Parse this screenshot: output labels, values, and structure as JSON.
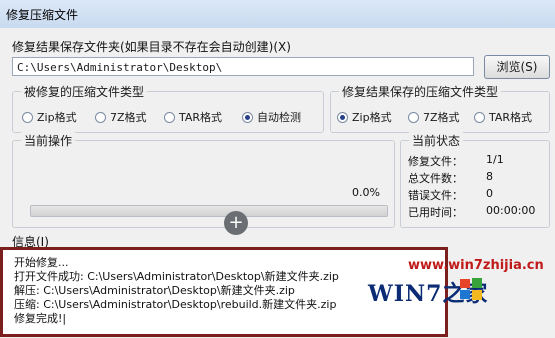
{
  "window": {
    "title": "修复压缩文件"
  },
  "save_folder": {
    "label": "修复结果保存文件夹(如果目录不存在会自动创建)(X)",
    "path": "C:\\Users\\Administrator\\Desktop\\",
    "browse_button": "浏览(S)"
  },
  "source_type": {
    "title": "被修复的压缩文件类型",
    "options": [
      {
        "label": "Zip格式",
        "selected": false
      },
      {
        "label": "7Z格式",
        "selected": false
      },
      {
        "label": "TAR格式",
        "selected": false
      },
      {
        "label": "自动检测",
        "selected": true
      }
    ]
  },
  "output_type": {
    "title": "修复结果保存的压缩文件类型",
    "options": [
      {
        "label": "Zip格式",
        "selected": true
      },
      {
        "label": "7Z格式",
        "selected": false
      },
      {
        "label": "TAR格式",
        "selected": false
      }
    ]
  },
  "current_operation": {
    "title": "当前操作",
    "percent_text": "0.0%",
    "progress": 0.0
  },
  "current_status": {
    "title": "当前状态",
    "rows": [
      {
        "key": "修复文件：",
        "value": "1/1"
      },
      {
        "key": "总文件数：",
        "value": "8"
      },
      {
        "key": "错误文件：",
        "value": "0"
      },
      {
        "key": "已用时间：",
        "value": "00:00:00"
      }
    ]
  },
  "info": {
    "label": "信息(I)",
    "lines": [
      "开始修复...",
      "打开文件成功: C:\\Users\\Administrator\\Desktop\\新建文件夹.zip",
      "解压: C:\\Users\\Administrator\\Desktop\\新建文件夹.zip",
      "压缩: C:\\Users\\Administrator\\Desktop\\rebuild.新建文件夹.zip",
      "修复完成!|"
    ]
  },
  "watermark": {
    "url": "www.win7zhijia.cn",
    "brand": "WIN7之家"
  },
  "colors": {
    "progress_fill": "#2ec02e",
    "log_border": "#7a1e1e",
    "watermark_red": "#c01a1a"
  }
}
